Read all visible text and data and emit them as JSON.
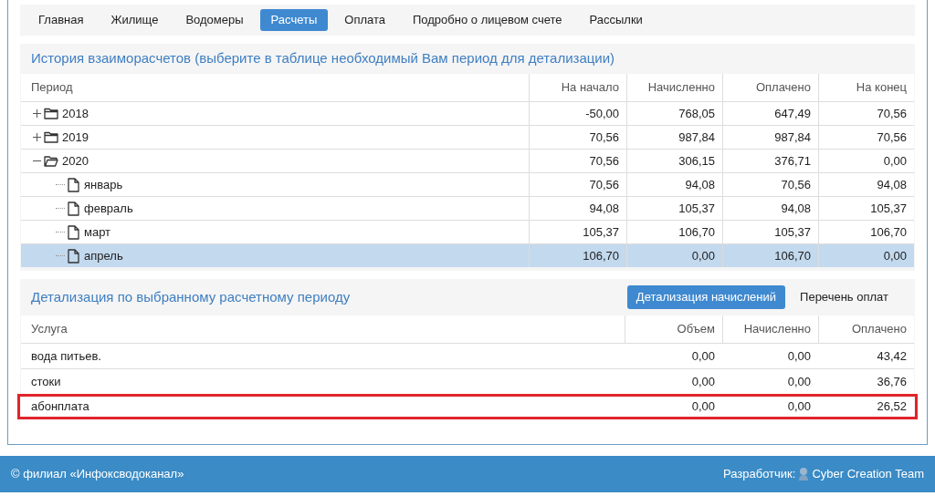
{
  "nav": {
    "tabs": [
      {
        "label": "Главная",
        "selected": false
      },
      {
        "label": "Жилище",
        "selected": false
      },
      {
        "label": "Водомеры",
        "selected": false
      },
      {
        "label": "Расчеты",
        "selected": true
      },
      {
        "label": "Оплата",
        "selected": false
      },
      {
        "label": "Подробно о лицевом счете",
        "selected": false
      },
      {
        "label": "Рассылки",
        "selected": false
      }
    ]
  },
  "history": {
    "title": "История взаиморасчетов (выберите в таблице необходимый Вам период для детализации)",
    "columns": [
      "Период",
      "На начало",
      "Начисленно",
      "Оплачено",
      "На конец"
    ],
    "rows": [
      {
        "period": "2018",
        "values": [
          "-50,00",
          "768,05",
          "647,49",
          "70,56"
        ],
        "expanded": false,
        "selected": false
      },
      {
        "period": "2019",
        "values": [
          "70,56",
          "987,84",
          "987,84",
          "70,56"
        ],
        "expanded": false,
        "selected": false
      },
      {
        "period": "2020",
        "values": [
          "70,56",
          "306,15",
          "376,71",
          "0,00"
        ],
        "expanded": true,
        "selected": false,
        "children": [
          {
            "period": "январь",
            "values": [
              "70,56",
              "94,08",
              "70,56",
              "94,08"
            ],
            "selected": false
          },
          {
            "period": "февраль",
            "values": [
              "94,08",
              "105,37",
              "94,08",
              "105,37"
            ],
            "selected": false
          },
          {
            "period": "март",
            "values": [
              "105,37",
              "106,70",
              "105,37",
              "106,70"
            ],
            "selected": false
          },
          {
            "period": "апрель",
            "values": [
              "106,70",
              "0,00",
              "106,70",
              "0,00"
            ],
            "selected": true
          }
        ]
      }
    ]
  },
  "details": {
    "title": "Детализация по выбранному расчетному периоду",
    "buttons": [
      {
        "label": "Детализация начислений",
        "selected": true
      },
      {
        "label": "Перечень оплат",
        "selected": false
      }
    ],
    "columns": [
      "Услуга",
      "Объем",
      "Начисленно",
      "Оплачено"
    ],
    "rows": [
      {
        "cells": [
          "вода питьев.",
          "0,00",
          "0,00",
          "43,42"
        ],
        "highlighted": false
      },
      {
        "cells": [
          "стоки",
          "0,00",
          "0,00",
          "36,76"
        ],
        "highlighted": false
      },
      {
        "cells": [
          "абонплата",
          "0,00",
          "0,00",
          "26,52"
        ],
        "highlighted": true
      }
    ]
  },
  "footer": {
    "copyright": "© филиал «Инфоксводоканал»",
    "developer_label": "Разработчик:",
    "developer_name": "Cyber Creation Team"
  }
}
